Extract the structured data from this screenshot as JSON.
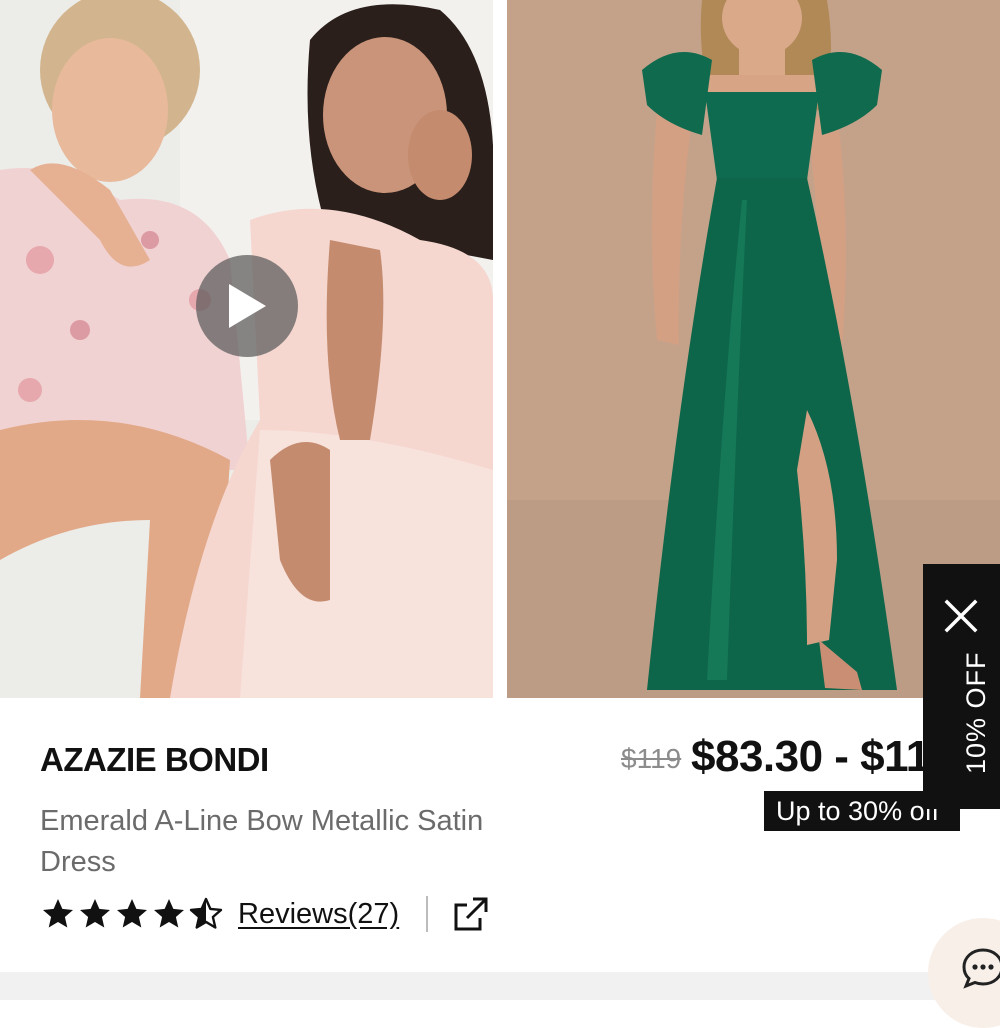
{
  "gallery": {
    "left_image": "Two women in blush dresses seated and posing",
    "right_image": "Model wearing emerald satin gown",
    "play_icon": "play-icon"
  },
  "promo": {
    "label": "10% OFF",
    "close_icon": "close-icon"
  },
  "product": {
    "brand": "AZAZIE BONDI",
    "name": "Emerald A-Line Bow Metallic Satin Dress",
    "rating": 4.5,
    "rating_max": 5,
    "reviews_label": "Reviews(27)",
    "share_icon": "share-external-icon"
  },
  "pricing": {
    "original_price": "$119",
    "price_range": "$83.30 - $119",
    "discount_badge": "Up to 30% off"
  },
  "chat": {
    "icon": "chat-icon"
  },
  "colors": {
    "emerald": "#0e6b4f",
    "badge_bg": "#111111",
    "muted_text": "#6b6b6b"
  }
}
